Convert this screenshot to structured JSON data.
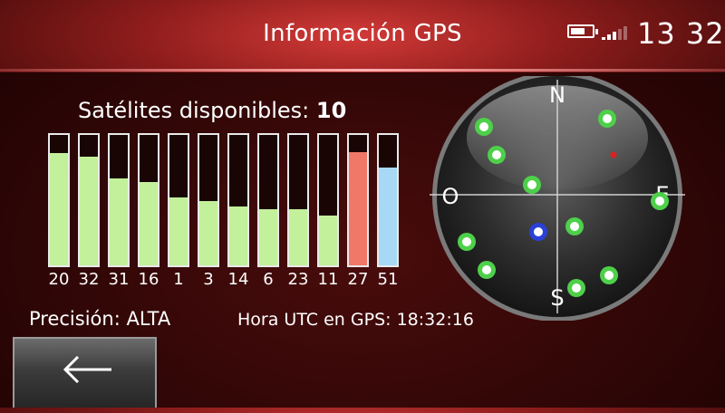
{
  "header": {
    "title": "Información GPS",
    "time": "13 32",
    "battery_level": 0.7,
    "signal_level": 0.6
  },
  "satellites": {
    "label": "Satélites disponibles:",
    "count": "10",
    "bars": [
      {
        "id": "20",
        "level": 0.86,
        "color": "#c3f09a"
      },
      {
        "id": "32",
        "level": 0.83,
        "color": "#c3f09a"
      },
      {
        "id": "31",
        "level": 0.67,
        "color": "#c3f09a"
      },
      {
        "id": "16",
        "level": 0.64,
        "color": "#c3f09a"
      },
      {
        "id": "1",
        "level": 0.52,
        "color": "#c3f09a"
      },
      {
        "id": "3",
        "level": 0.49,
        "color": "#c3f09a"
      },
      {
        "id": "14",
        "level": 0.45,
        "color": "#c3f09a"
      },
      {
        "id": "6",
        "level": 0.43,
        "color": "#c3f09a"
      },
      {
        "id": "23",
        "level": 0.43,
        "color": "#c3f09a"
      },
      {
        "id": "11",
        "level": 0.38,
        "color": "#c3f09a"
      },
      {
        "id": "27",
        "level": 0.87,
        "color": "#f07868"
      },
      {
        "id": "51",
        "level": 0.75,
        "color": "#a7d8f5"
      }
    ]
  },
  "status": {
    "precision_label": "Precisión:",
    "precision_value": "ALTA",
    "utc_label": "Hora UTC en GPS:",
    "utc_value": "18:32:16"
  },
  "compass": {
    "north": "N",
    "south": "S",
    "east": "E",
    "west": "O"
  },
  "colors": {
    "satellite_dot": "#4ed04a",
    "own_position_dot": "#2a40d8",
    "marker_dot": "#e02020"
  },
  "back_button": {
    "icon": "arrow-left-icon"
  }
}
